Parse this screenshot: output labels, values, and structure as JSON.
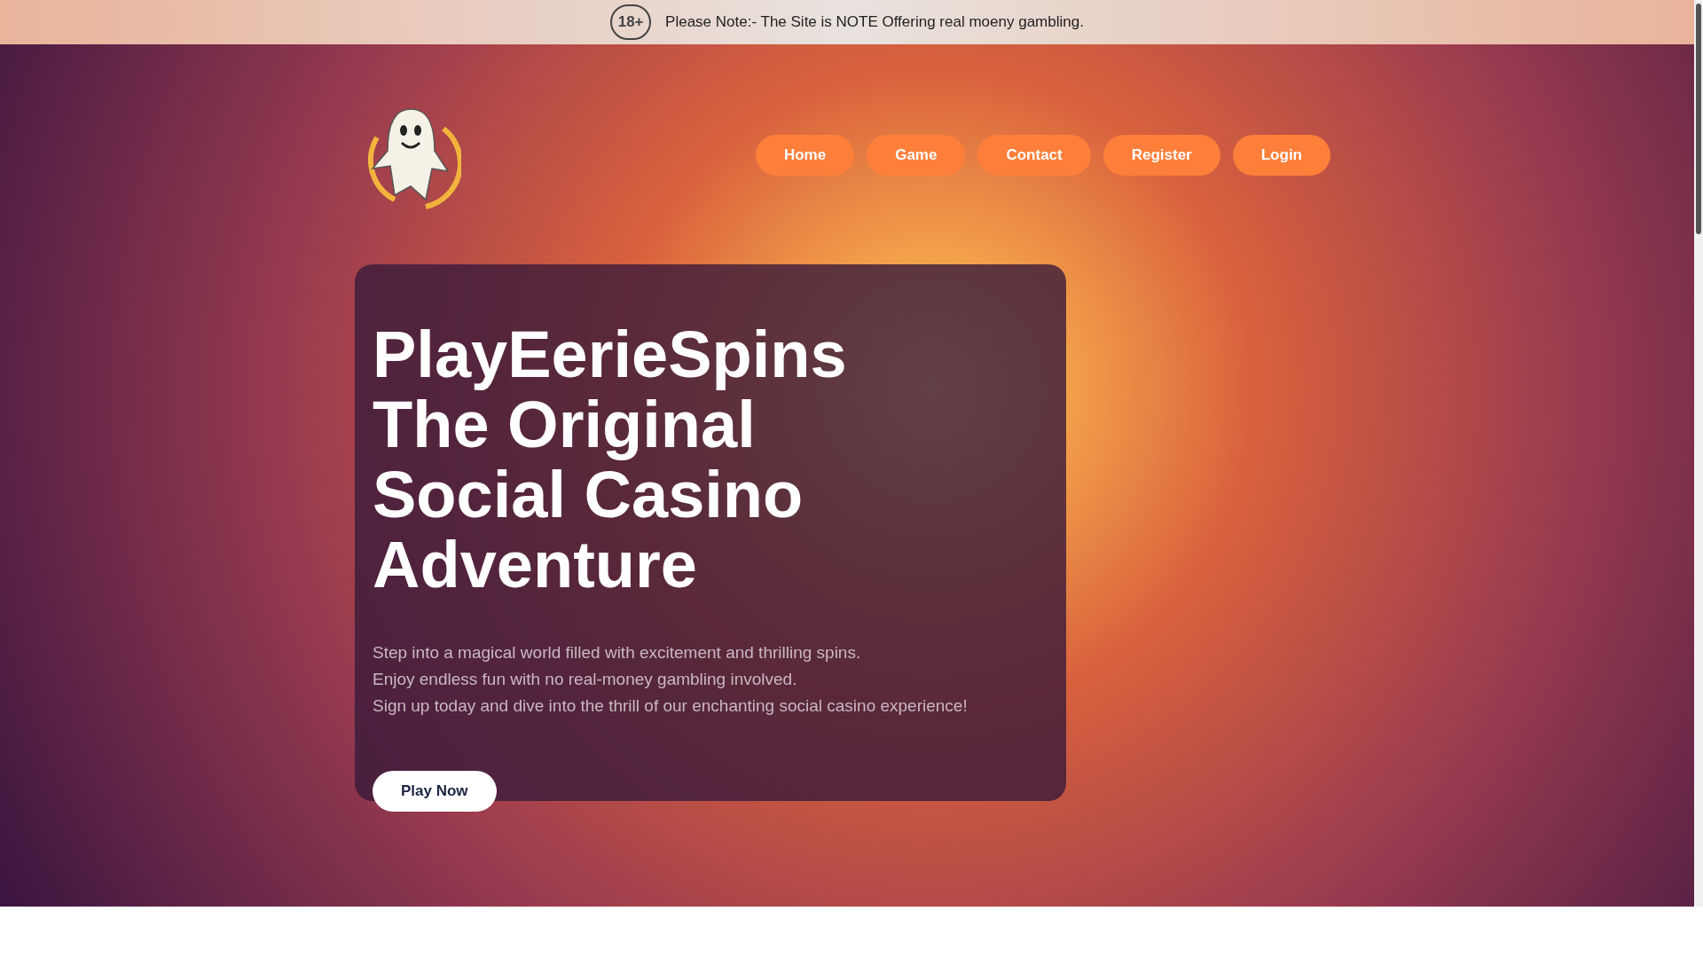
{
  "notice_bar": {
    "badge": "18+",
    "text": "Please Note:- The Site is NOTE Offering real moeny gambling."
  },
  "nav": {
    "items": [
      {
        "label": "Home"
      },
      {
        "label": "Game"
      },
      {
        "label": "Contact"
      },
      {
        "label": "Register"
      },
      {
        "label": "Login"
      }
    ]
  },
  "hero": {
    "title_lines": [
      "PlayEerieSpins",
      "The Original",
      "Social Casino",
      "Adventure"
    ],
    "description_lines": [
      "Step into a magical world filled with excitement and thrilling spins.",
      "Enjoy endless fun with no real-money gambling involved.",
      "Sign up today and dive into the thrill of our enchanting social casino experience!"
    ],
    "button": "Play Now"
  }
}
